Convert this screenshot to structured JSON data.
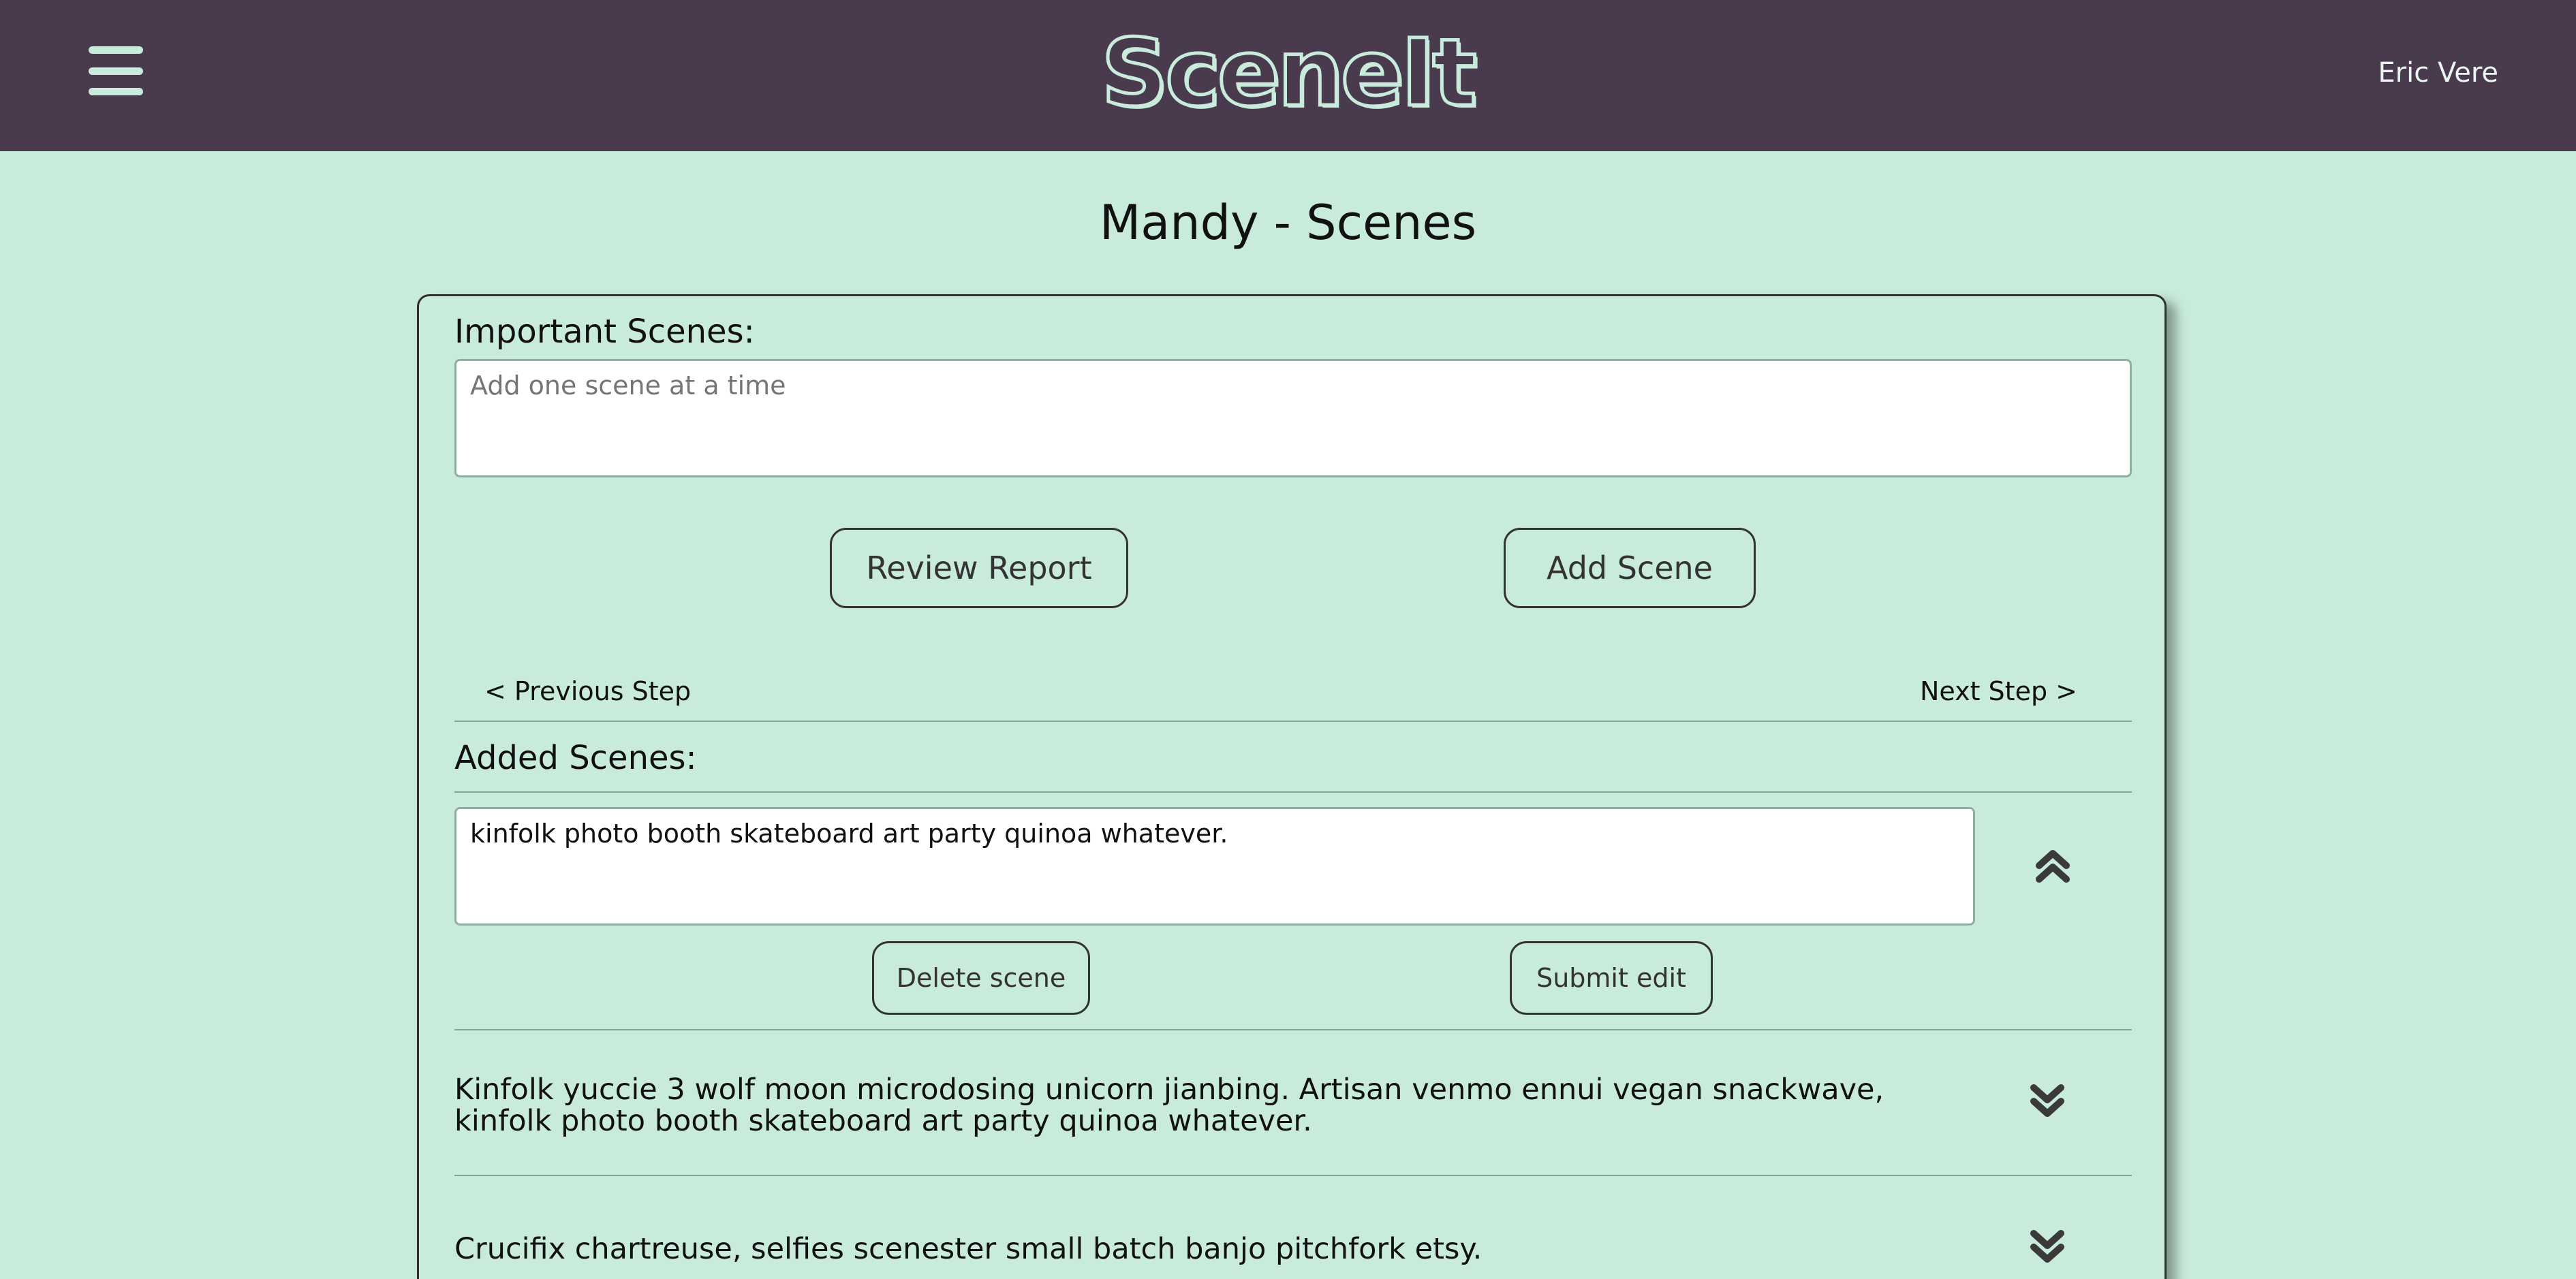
{
  "header": {
    "logo_text": "SceneIt",
    "user_name": "Eric Vere",
    "menu_icon": "hamburger-menu-icon",
    "colors": {
      "bar": "#4a3a4e",
      "accent": "#c8ebdc"
    }
  },
  "page": {
    "title": "Mandy - Scenes",
    "background": "#c8ebdc"
  },
  "form": {
    "important_label": "Important Scenes:",
    "scene_placeholder": "Add one scene at a time",
    "review_button": "Review Report",
    "add_button": "Add Scene",
    "previous_step": "< Previous Step",
    "next_step": "Next Step >"
  },
  "added": {
    "label": "Added Scenes:",
    "editing": {
      "value": "kinfolk photo booth skateboard art party quinoa whatever.",
      "delete_button": "Delete scene",
      "submit_button": "Submit edit",
      "toggle_icon": "chevron-double-up-icon"
    },
    "scenes": [
      {
        "text": "Kinfolk yuccie 3 wolf moon microdosing unicorn jianbing. Artisan venmo ennui vegan snackwave, kinfolk photo booth skateboard art party quinoa whatever.",
        "toggle_icon": "chevron-double-down-icon"
      },
      {
        "text": "Crucifix chartreuse, selfies scenester small batch banjo pitchfork etsy.",
        "toggle_icon": "chevron-double-down-icon"
      }
    ]
  }
}
